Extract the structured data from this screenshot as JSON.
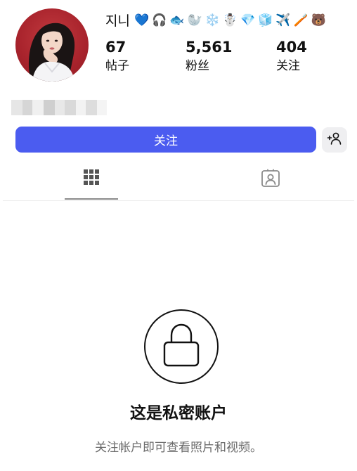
{
  "profile": {
    "username": "지니",
    "emojis": [
      "💙",
      "🎧",
      "🐟",
      "🦭",
      "❄️",
      "☃️",
      "💎",
      "🧊",
      "✈️",
      "🪥",
      "🐻"
    ],
    "stats": [
      {
        "value": "67",
        "label": "帖子"
      },
      {
        "value": "5,561",
        "label": "粉丝"
      },
      {
        "value": "404",
        "label": "关注"
      }
    ]
  },
  "actions": {
    "follow_label": "关注"
  },
  "tabs": {
    "active": "posts-grid"
  },
  "private_notice": {
    "title": "这是私密账户",
    "description": "关注帐户即可查看照片和视频。"
  },
  "icons": {
    "suggest": "add-person-icon",
    "grid": "grid-icon",
    "tagged": "tagged-person-icon",
    "lock": "lock-icon"
  },
  "colors": {
    "accent": "#4b5cf0",
    "avatar_bg": "#a8232c"
  }
}
